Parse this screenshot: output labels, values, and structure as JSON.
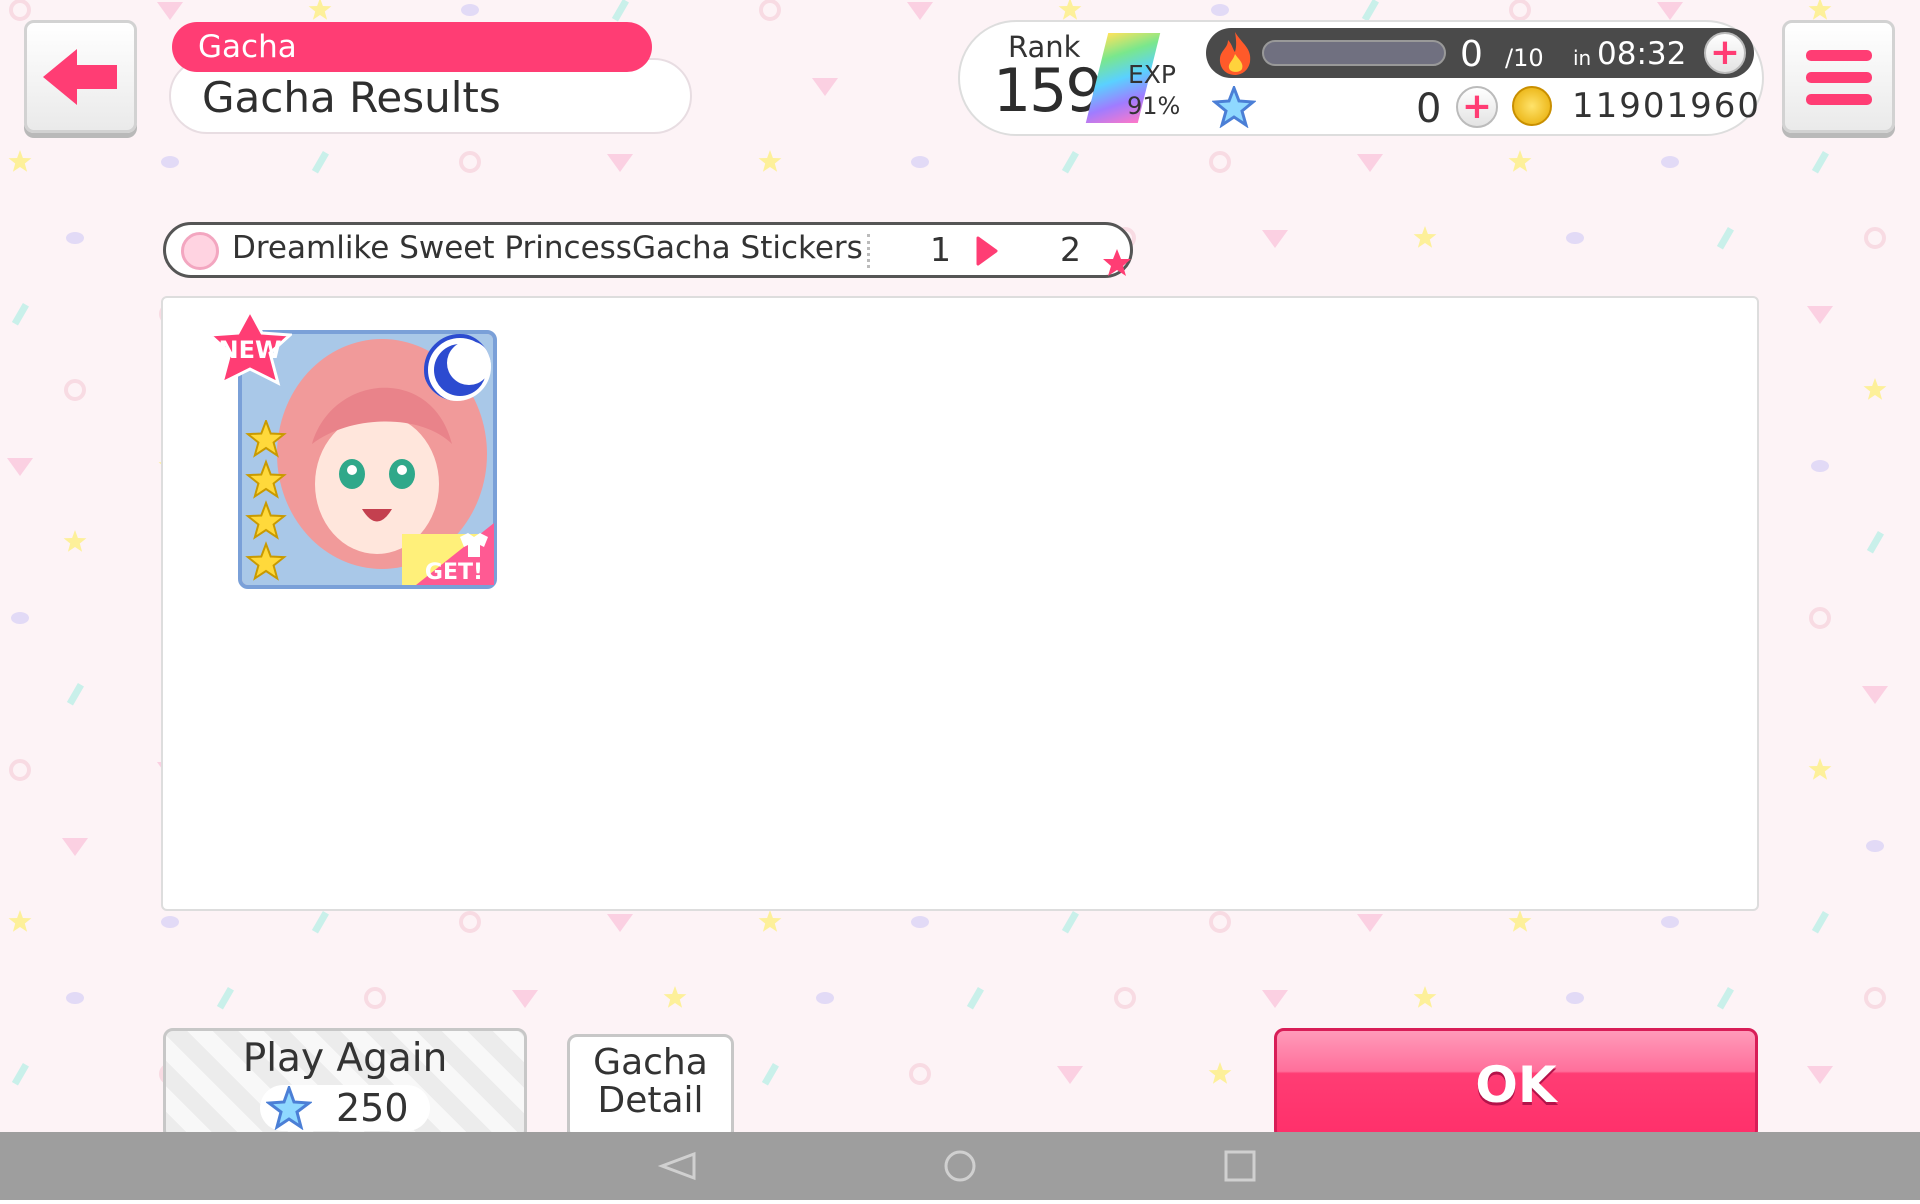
{
  "header": {
    "category": "Gacha",
    "title": "Gacha Results"
  },
  "status": {
    "rank_label": "Rank",
    "rank_value": "159",
    "exp_label": "EXP",
    "exp_percent": "91%",
    "stamina_current": "0",
    "stamina_max": "/10",
    "stamina_in": "in",
    "stamina_timer": "08:32",
    "star_gems": "0",
    "coins": "11901960"
  },
  "gacha_tab": {
    "name": "Dreamlike Sweet PrincessGacha Stickers",
    "page_current": "1",
    "page_total": "2"
  },
  "result_card": {
    "badge_new": "NEW",
    "badge_get": "GET!",
    "rarity_stars": 4,
    "attribute": "moon"
  },
  "buttons": {
    "play_again": "Play Again",
    "play_again_cost": "250",
    "gacha_detail_line1": "Gacha",
    "gacha_detail_line2": "Detail",
    "ok": "OK"
  },
  "colors": {
    "accent": "#ff3d74",
    "background": "#fdf3f6"
  }
}
